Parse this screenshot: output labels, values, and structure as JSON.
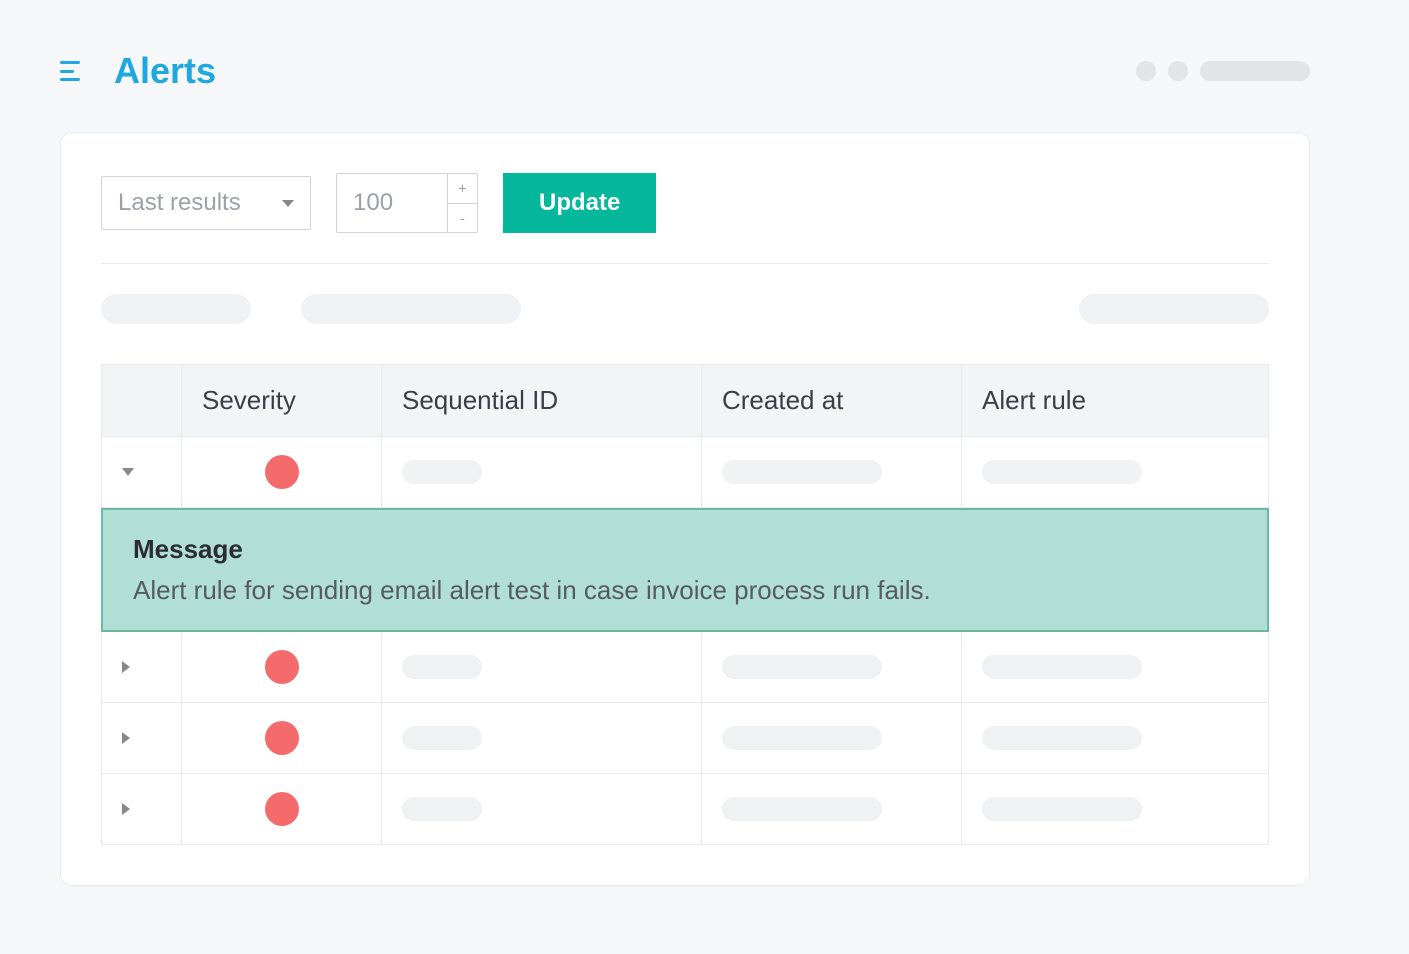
{
  "header": {
    "title": "Alerts"
  },
  "filters": {
    "results_label": "Last results",
    "count_value": "100",
    "update_label": "Update"
  },
  "table": {
    "headers": {
      "severity": "Severity",
      "sequential_id": "Sequential ID",
      "created_at": "Created at",
      "alert_rule": "Alert rule"
    }
  },
  "message": {
    "heading": "Message",
    "body": "Alert rule for sending email alert test in case invoice process run fails."
  },
  "colors": {
    "brand": "#1FA8E0",
    "primary_action": "#06B89B",
    "severity_high": "#F56B6B",
    "panel_bg": "#B2DFD5"
  }
}
